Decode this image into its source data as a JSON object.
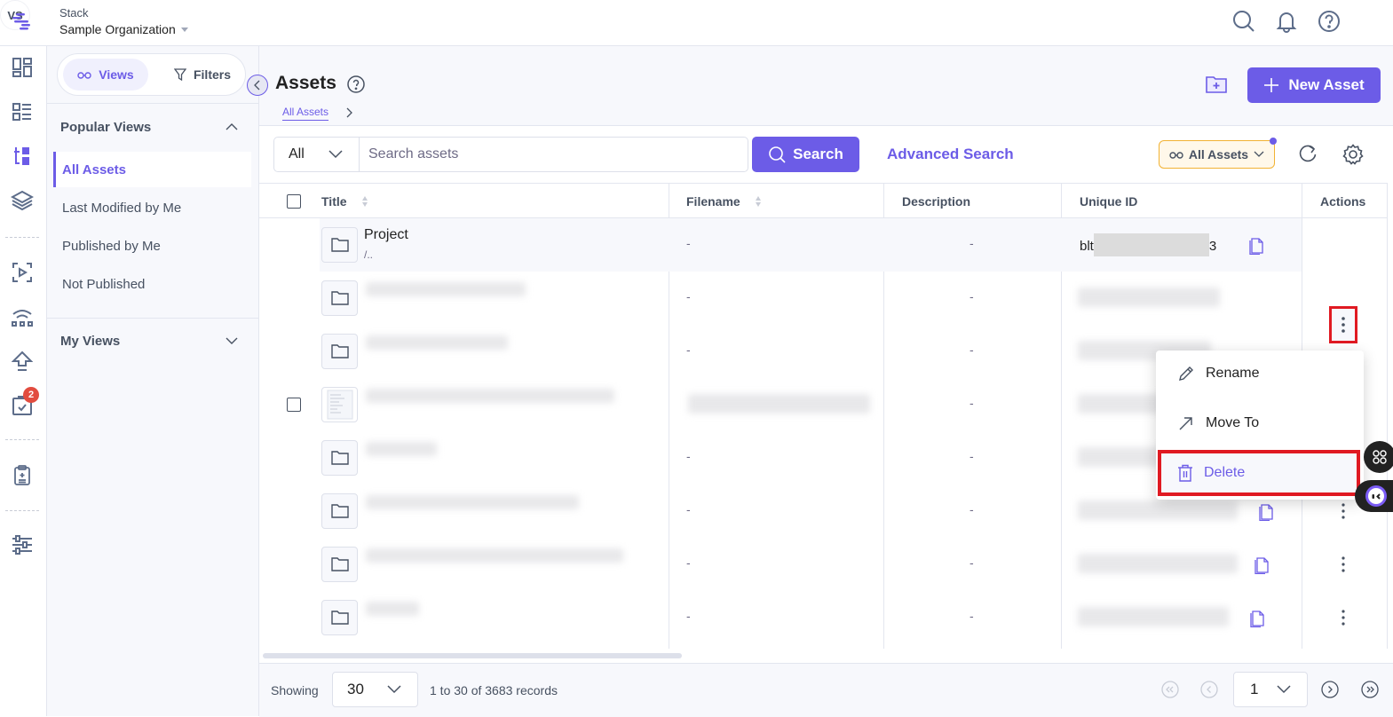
{
  "topbar": {
    "app_label": "Stack",
    "org_name": "Sample Organization",
    "avatar_initials": "VS",
    "icons": [
      "search-icon",
      "bell-icon",
      "help-icon"
    ]
  },
  "rail": {
    "items": [
      "dashboard-icon",
      "entries-icon",
      "assets-icon",
      "stack-layers-icon",
      "preview-icon",
      "network-icon",
      "deploy-icon",
      "tasks-icon",
      "releases-icon",
      "settings-sliders-icon"
    ],
    "tasks_badge": "2",
    "active": "assets-icon"
  },
  "sidepanel": {
    "views_tab": "Views",
    "filters_tab": "Filters",
    "popular_views_title": "Popular Views",
    "popular_views": [
      {
        "label": "All Assets",
        "active": true
      },
      {
        "label": "Last Modified by Me",
        "active": false
      },
      {
        "label": "Published by Me",
        "active": false
      },
      {
        "label": "Not Published",
        "active": false
      }
    ],
    "my_views_title": "My Views"
  },
  "header": {
    "title": "Assets",
    "breadcrumb": "All Assets",
    "new_asset_label": "New Asset"
  },
  "toolbar": {
    "type_select": "All",
    "search_placeholder": "Search assets",
    "search_value": "",
    "search_button": "Search",
    "advanced_search": "Advanced Search",
    "view_chip": "All Assets"
  },
  "table": {
    "columns": [
      "Title",
      "Filename",
      "Description",
      "Unique ID",
      "Actions"
    ],
    "rows": [
      {
        "type": "folder",
        "title": "Project",
        "subtitle": "/..",
        "filename": "-",
        "description": "-",
        "uid_prefix": "blt",
        "uid_suffix": "3",
        "redacted": false
      },
      {
        "type": "folder",
        "title": "[redacted]",
        "filename": "-",
        "description": "-",
        "redacted": true
      },
      {
        "type": "folder",
        "title": "[redacted]",
        "filename": "-",
        "description": "-",
        "redacted": true
      },
      {
        "type": "file",
        "title": "[redacted]",
        "filename": "[redacted]",
        "description": "-",
        "redacted": true
      },
      {
        "type": "folder",
        "title": "[redacted]",
        "filename": "-",
        "description": "-",
        "redacted": true
      },
      {
        "type": "folder",
        "title": "[redacted]",
        "filename": "-",
        "description": "-",
        "redacted": true
      },
      {
        "type": "folder",
        "title": "[redacted]",
        "filename": "-",
        "description": "-",
        "redacted": true
      },
      {
        "type": "folder",
        "title": "[redacted]",
        "filename": "-",
        "description": "-",
        "redacted": true
      }
    ]
  },
  "action_menu": {
    "items": [
      {
        "label": "Rename",
        "icon": "pencil-icon"
      },
      {
        "label": "Move To",
        "icon": "arrow-up-right-icon"
      },
      {
        "label": "Delete",
        "icon": "trash-icon",
        "highlighted": true
      }
    ]
  },
  "footer": {
    "showing_label": "Showing",
    "page_size": "30",
    "records_text": "1 to 30 of 3683 records",
    "current_page": "1"
  },
  "colors": {
    "accent": "#6c5ce7",
    "highlight_border": "#e01a22",
    "badge": "#e24c3f",
    "chip_border": "#f2b233"
  }
}
